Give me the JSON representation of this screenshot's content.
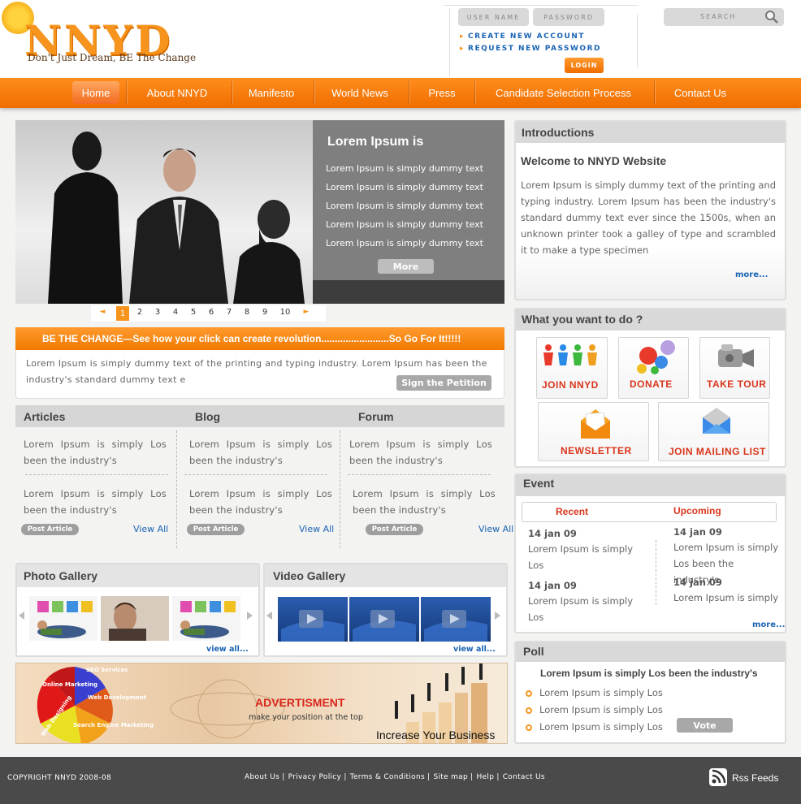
{
  "header": {
    "logo_text": "NNYD",
    "tagline": "Don't Just Dream, BE The Change",
    "username_placeholder": "USER NAME",
    "password_placeholder": "PASSWORD",
    "create_account": "CREATE NEW ACCOUNT",
    "request_password": "REQUEST NEW PASSWORD",
    "login_label": "LOGIN",
    "search_placeholder": "SEARCH"
  },
  "nav": {
    "items": [
      "Home",
      "About NNYD",
      "Manifesto",
      "World News",
      "Press",
      "Candidate Selection Process",
      "Contact Us"
    ],
    "active": "Home"
  },
  "slider": {
    "title": "Lorem Ipsum is",
    "lines": [
      "Lorem Ipsum is simply dummy text",
      "Lorem Ipsum is simply dummy text",
      "Lorem Ipsum is simply dummy text",
      "Lorem Ipsum is simply dummy text",
      "Lorem Ipsum is simply dummy text"
    ],
    "more_label": "More",
    "pages": [
      "1",
      "2",
      "3",
      "4",
      "5",
      "6",
      "7",
      "8",
      "9",
      "10"
    ],
    "prev": "◄",
    "next": "►"
  },
  "petition": {
    "heading": "BE THE CHANGE—See how your click can create revolution.........................So Go For It!!!!!",
    "text": "Lorem Ipsum is simply dummy text of the printing and typing industry. Lorem Ipsum has been the industry's standard dummy text e",
    "button": "Sign the Petition"
  },
  "columns": {
    "articles": {
      "title": "Articles",
      "items": [
        "Lorem Ipsum is simply Los been the industry's",
        "Lorem Ipsum is simply Los been the industry's"
      ],
      "post_label": "Post Article",
      "view_all": "View All"
    },
    "blog": {
      "title": "Blog",
      "items": [
        "Lorem Ipsum is simply Los been the industry's",
        "Lorem Ipsum is simply Los been the industry's"
      ],
      "post_label": "Post Article",
      "view_all": "View All"
    },
    "forum": {
      "title": "Forum",
      "items": [
        "Lorem Ipsum is simply Los been the industry's",
        "Lorem Ipsum is simply Los been the industry's"
      ],
      "post_label": "Post Article",
      "view_all": "View All"
    }
  },
  "photo_gallery": {
    "title": "Photo Gallery",
    "view_all": "view all..."
  },
  "video_gallery": {
    "title": "Video Gallery",
    "view_all": "view all..."
  },
  "advert": {
    "title": "ADVERTISMENT",
    "subtitle": "make your position at the top",
    "tagline": "Increase Your Business",
    "pie_labels": [
      "SEO Services",
      "Web Development",
      "Search Engine Marketing",
      "Web Designing",
      "Online Marketing"
    ]
  },
  "introductions": {
    "title": "Introductions",
    "welcome": "Welcome  to NNYD Website",
    "text": "Lorem Ipsum is simply dummy text of the printing and typing industry. Lorem Ipsum has been the industry's standard dummy text ever since the 1500s, when an unknown printer took a galley of type and scrambled it to make a type specimen",
    "more": "more..."
  },
  "what_to_do": {
    "title": "What you want to do ?",
    "actions": [
      "JOIN NNYD",
      "DONATE",
      "TAKE TOUR",
      "NEWSLETTER",
      "JOIN MAILING LIST"
    ]
  },
  "event": {
    "title": "Event",
    "tab_recent": "Recent",
    "tab_upcoming": "Upcoming",
    "recent": [
      {
        "date": "14 jan 09",
        "text": "Lorem Ipsum is simply Los"
      },
      {
        "date": "14 jan 09",
        "text": "Lorem Ipsum is simply Los"
      }
    ],
    "upcoming": [
      {
        "date": "14 jan 09",
        "text": "Lorem Ipsum is simply Los been the industry's"
      },
      {
        "date": "14 jan 09",
        "text": "Lorem Ipsum is simply"
      }
    ],
    "more": "more..."
  },
  "poll": {
    "title": "Poll",
    "question": "Lorem Ipsum is simply Los been the industry's",
    "options": [
      "Lorem Ipsum is simply Los",
      "Lorem Ipsum is simply Los",
      "Lorem Ipsum is simply Los"
    ],
    "vote_label": "Vote"
  },
  "footer": {
    "copyright": "COPYRIGHT  NNYD 2008-08",
    "links": [
      "About Us |",
      "Privacy Policy |",
      "Terms & Conditions |",
      "Site map |",
      "Help |",
      "Contact Us"
    ],
    "rss": "Rss Feeds"
  },
  "colors": {
    "accent": "#f7941d",
    "link": "#1a64b4",
    "red": "#d9361c",
    "footer": "#4a4a4a"
  }
}
